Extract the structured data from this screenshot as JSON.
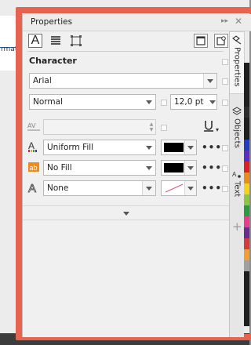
{
  "background": {
    "ruler_text": "rmat",
    "highlight_color": "#e5634f"
  },
  "panel": {
    "title": "Properties",
    "titlebar_icons": [
      "double-arrow-icon",
      "close-icon"
    ],
    "tabs": [
      {
        "name": "character-tab",
        "icon": "character-A-icon",
        "active": true
      },
      {
        "name": "paragraph-tab",
        "icon": "paragraph-icon",
        "active": false
      },
      {
        "name": "frame-tab",
        "icon": "frame-icon",
        "active": false
      }
    ],
    "section_title": "Character",
    "font_family": "Arial",
    "font_style": "Normal",
    "font_size": "12,0 pt",
    "fill": {
      "label": "Uniform Fill",
      "color": "#000000"
    },
    "background_fill": {
      "label": "No Fill",
      "color": "#000000"
    },
    "outline": {
      "label": "None"
    },
    "more": "•••"
  },
  "side_tabs": [
    {
      "label": "Properties",
      "icon": "properties-icon",
      "active": true
    },
    {
      "label": "Objects",
      "icon": "layers-icon",
      "active": false
    },
    {
      "label": "Text",
      "icon": "text-icon",
      "active": false
    }
  ],
  "add_tab": "+",
  "palette_colors": [
    "#1e1e1e",
    "#1e1e1e",
    "#1e1e1e",
    "#1e1e1e",
    "#2c2c2c",
    "#1e1e1e",
    "#1e1e1e",
    "#1f3fbf",
    "#5a2fbf",
    "#e02020",
    "#f08a1a",
    "#f5d21a",
    "#8dc63f",
    "#2a9b3e",
    "#e83d8a",
    "#6a2c91",
    "#d83a3a",
    "#f0a030",
    "#a0a0a0",
    "#1e1e1e",
    "#1e1e1e",
    "#1e1e1e",
    "#1e1e1e",
    "#1e1e1e"
  ]
}
